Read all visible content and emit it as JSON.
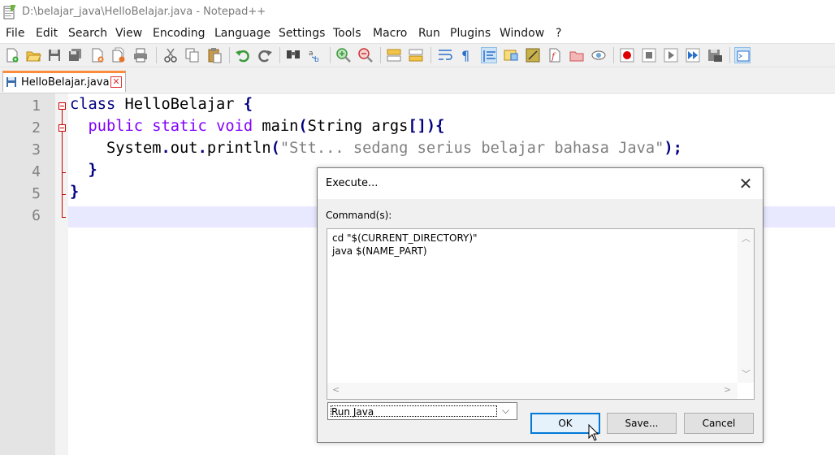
{
  "window": {
    "title": "D:\\belajar_java\\HelloBelajar.java - Notepad++"
  },
  "menu": {
    "items": [
      "File",
      "Edit",
      "Search",
      "View",
      "Encoding",
      "Language",
      "Settings",
      "Tools",
      "Macro",
      "Run",
      "Plugins",
      "Window",
      "?"
    ]
  },
  "toolbar": {
    "icons": [
      "new-file",
      "open-file",
      "save",
      "save-all",
      "close",
      "close-all",
      "print",
      "cut",
      "copy",
      "paste",
      "undo",
      "redo",
      "find",
      "replace",
      "zoom-in",
      "zoom-out",
      "sync-vertical",
      "sync-horizontal",
      "word-wrap",
      "show-all-chars",
      "indent-guide",
      "doc-map",
      "function-list",
      "folder-workspace",
      "pencil",
      "monitor",
      "record-macro",
      "stop-macro",
      "play-macro",
      "run-macro-multiple",
      "save-macro",
      "launch-console"
    ]
  },
  "tabs": [
    {
      "label": "HelloBelajar.java"
    }
  ],
  "editor": {
    "line_numbers": [
      "1",
      "2",
      "3",
      "4",
      "5",
      "6"
    ],
    "current_line": 6,
    "lines": [
      {
        "indent": "",
        "parts": [
          {
            "t": "class",
            "c": "kw1"
          },
          {
            "t": " HelloBelajar ",
            "c": ""
          },
          {
            "t": "{",
            "c": "op"
          }
        ]
      },
      {
        "indent": "  ",
        "parts": [
          {
            "t": "public",
            "c": "kw2"
          },
          {
            "t": " ",
            "c": ""
          },
          {
            "t": "static",
            "c": "kw2"
          },
          {
            "t": " ",
            "c": ""
          },
          {
            "t": "void",
            "c": "kw2"
          },
          {
            "t": " main",
            "c": ""
          },
          {
            "t": "(",
            "c": "op"
          },
          {
            "t": "String args",
            "c": ""
          },
          {
            "t": "[]){",
            "c": "op"
          }
        ]
      },
      {
        "indent": "    ",
        "parts": [
          {
            "t": "System",
            "c": ""
          },
          {
            "t": ".",
            "c": "op"
          },
          {
            "t": "out",
            "c": ""
          },
          {
            "t": ".",
            "c": "op"
          },
          {
            "t": "println",
            "c": ""
          },
          {
            "t": "(",
            "c": "op"
          },
          {
            "t": "\"Stt... sedang serius belajar bahasa Java\"",
            "c": "str"
          },
          {
            "t": ");",
            "c": "op"
          }
        ]
      },
      {
        "indent": "  ",
        "parts": [
          {
            "t": "}",
            "c": "op"
          }
        ]
      },
      {
        "indent": "",
        "parts": [
          {
            "t": "}",
            "c": "op"
          }
        ]
      },
      {
        "indent": "",
        "parts": []
      }
    ]
  },
  "dialog": {
    "title": "Execute...",
    "close_glyph": "✕",
    "commands_label": "Command(s):",
    "commands": [
      "cd \"$(CURRENT_DIRECTORY)\"",
      "java $(NAME_PART)"
    ],
    "select_value": "Run Java",
    "ok_label": "OK",
    "save_label": "Save...",
    "cancel_label": "Cancel"
  }
}
